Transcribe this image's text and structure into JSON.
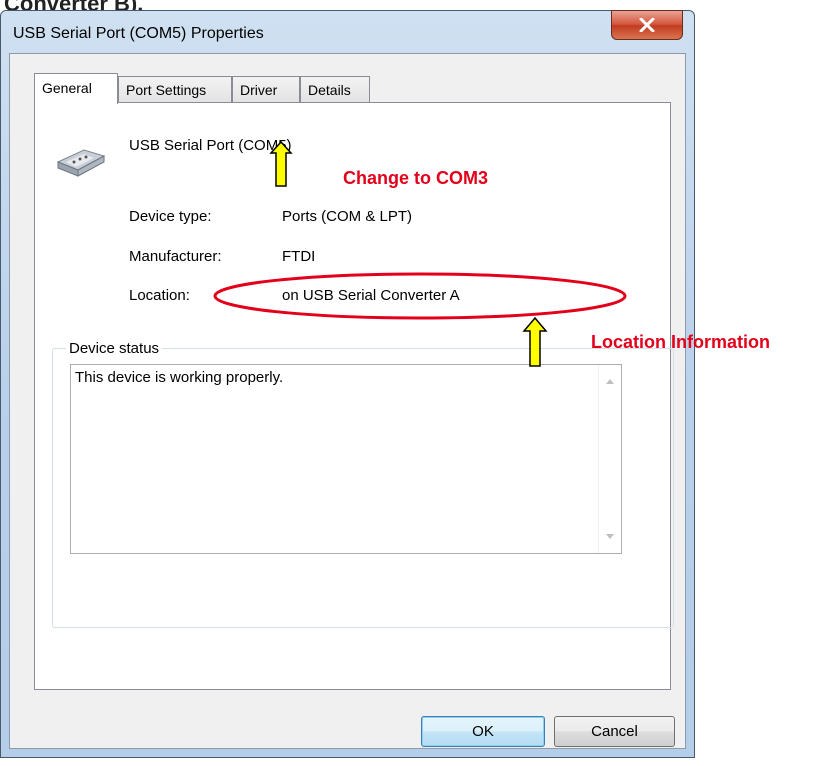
{
  "top_text": "Converter B).",
  "window": {
    "title": "USB Serial Port (COM5) Properties"
  },
  "tabs": [
    {
      "label": "General"
    },
    {
      "label": "Port Settings"
    },
    {
      "label": "Driver"
    },
    {
      "label": "Details"
    }
  ],
  "device": {
    "name": "USB Serial Port (COM5)",
    "icon": "serial-port-icon"
  },
  "properties": {
    "device_type_label": "Device type:",
    "device_type_value": "Ports (COM & LPT)",
    "manufacturer_label": "Manufacturer:",
    "manufacturer_value": "FTDI",
    "location_label": "Location:",
    "location_value": "on USB Serial Converter A"
  },
  "device_status": {
    "legend": "Device status",
    "text": "This device is working properly."
  },
  "buttons": {
    "ok": "OK",
    "cancel": "Cancel"
  },
  "annotations": {
    "com_note": "Change to COM3",
    "location_note": "Location Information",
    "color": "#e3001b",
    "arrow_fill": "#ffff00"
  }
}
